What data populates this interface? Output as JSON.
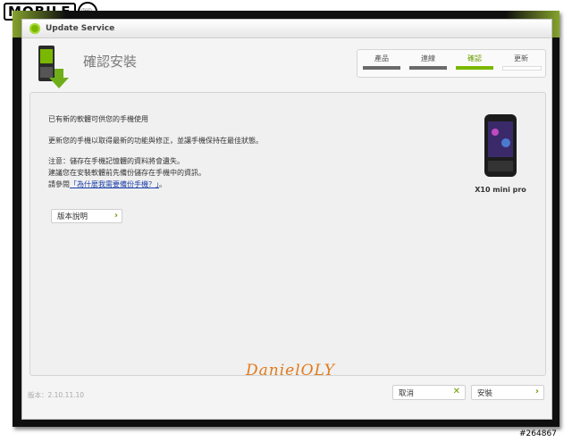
{
  "site": {
    "logo_text": "MOBILE"
  },
  "window": {
    "title": "Update Service",
    "header_title": "確認安裝"
  },
  "steps": [
    {
      "label": "產品",
      "state": "done"
    },
    {
      "label": "連線",
      "state": "done"
    },
    {
      "label": "確認",
      "state": "active"
    },
    {
      "label": "更新",
      "state": "todo"
    }
  ],
  "content": {
    "heading": "已有新的軟體可供您的手機使用",
    "description": "更新您的手機以取得最新的功能與修正，並讓手機保持在最佳狀態。",
    "note_line1": "注意：儲存在手機記憶體的資料將會遺失。",
    "note_line2": "建議您在安裝軟體前先備份儲存在手機中的資訊。",
    "note_line3_prefix": "請參閱",
    "note_link": "「為什麼我需要備份手機？」",
    "note_line3_suffix": "。",
    "release_notes_button": "版本說明",
    "device_name": "X10 mini pro"
  },
  "footer": {
    "version": "版本：2.10.11.10",
    "cancel_label": "取消",
    "install_label": "安裝"
  },
  "signature": "DanielOLY",
  "watermark": "#264867",
  "colors": {
    "accent": "#7ab800",
    "link": "#1a3ea8",
    "signature": "#e07a1a"
  }
}
